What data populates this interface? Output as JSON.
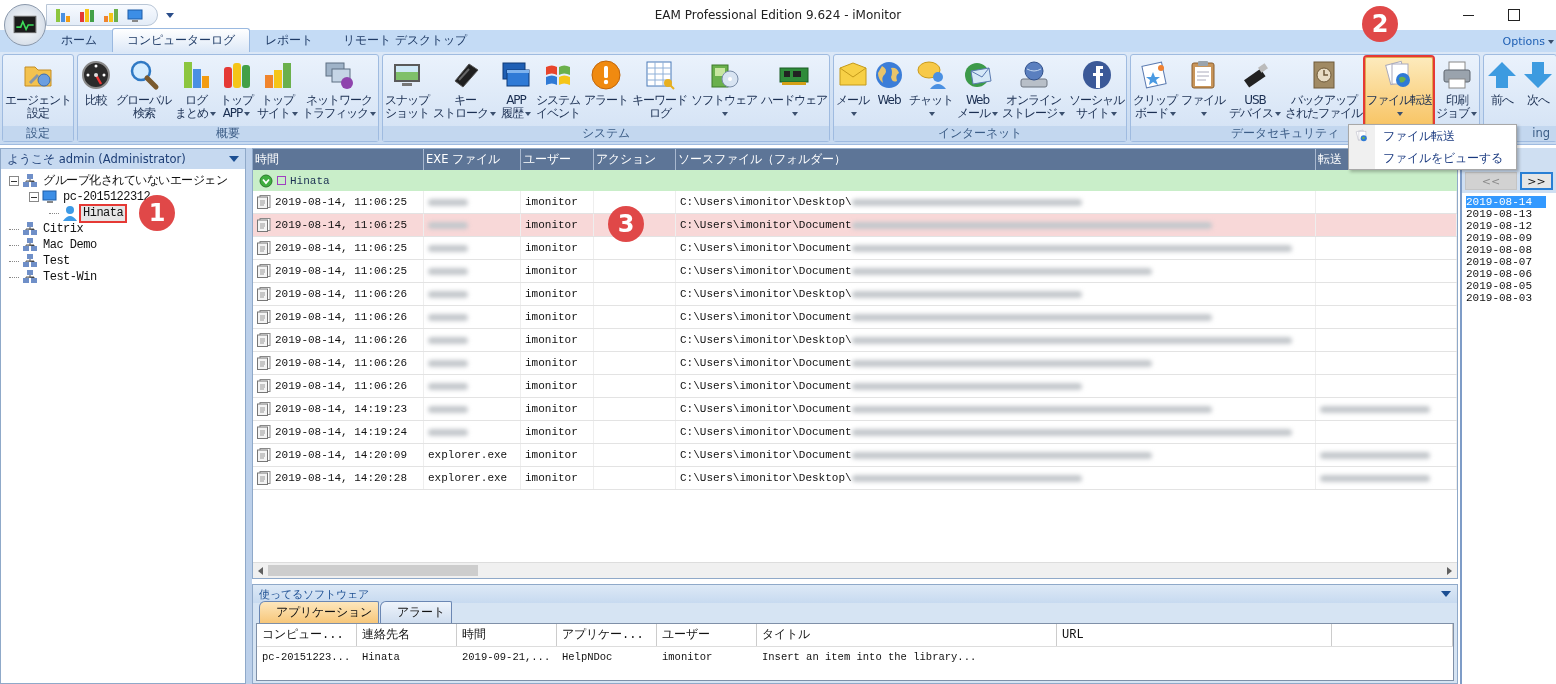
{
  "window": {
    "title": "EAM Professional Edition 9.624 - iMonitor"
  },
  "tabs": [
    {
      "label": "ホーム",
      "selected": false
    },
    {
      "label": "コンピューターログ",
      "selected": true
    },
    {
      "label": "レポート",
      "selected": false
    },
    {
      "label": "リモート デスクトップ",
      "selected": false
    }
  ],
  "options": {
    "label": "Options"
  },
  "ribbon": {
    "groups": [
      {
        "label": "設定",
        "buttons": [
          {
            "lines": [
              "エージェント",
              "設定"
            ],
            "dropdown": false,
            "open": false,
            "boxed": false
          }
        ]
      },
      {
        "label": "概要",
        "buttons": [
          {
            "lines": [
              "比較"
            ],
            "dropdown": false,
            "open": false,
            "boxed": false
          },
          {
            "lines": [
              "グローバル",
              "検索"
            ],
            "dropdown": false,
            "open": false,
            "boxed": false
          },
          {
            "lines": [
              "ログ",
              "まとめ"
            ],
            "dropdown": true,
            "open": false,
            "boxed": false
          },
          {
            "lines": [
              "トップ",
              "APP"
            ],
            "dropdown": true,
            "open": false,
            "boxed": false
          },
          {
            "lines": [
              "トップ",
              "サイト"
            ],
            "dropdown": true,
            "open": false,
            "boxed": false
          },
          {
            "lines": [
              "ネットワーク",
              "トラフィック"
            ],
            "dropdown": true,
            "open": false,
            "boxed": false
          }
        ]
      },
      {
        "label": "システム",
        "buttons": [
          {
            "lines": [
              "スナップ",
              "ショット"
            ],
            "dropdown": false,
            "open": false,
            "boxed": false
          },
          {
            "lines": [
              "キー",
              "ストローク"
            ],
            "dropdown": true,
            "open": false,
            "boxed": false
          },
          {
            "lines": [
              "APP",
              "履歴"
            ],
            "dropdown": true,
            "open": false,
            "boxed": false
          },
          {
            "lines": [
              "システム",
              "イベント"
            ],
            "dropdown": false,
            "open": false,
            "boxed": false
          },
          {
            "lines": [
              "アラート"
            ],
            "dropdown": false,
            "open": false,
            "boxed": false
          },
          {
            "lines": [
              "キーワード",
              "ログ"
            ],
            "dropdown": false,
            "open": false,
            "boxed": false
          },
          {
            "lines": [
              "ソフトウェア"
            ],
            "dropdown": true,
            "open": false,
            "boxed": false
          },
          {
            "lines": [
              "ハードウェア"
            ],
            "dropdown": true,
            "open": false,
            "boxed": false
          }
        ]
      },
      {
        "label": "インターネット",
        "buttons": [
          {
            "lines": [
              "メール"
            ],
            "dropdown": true,
            "open": false,
            "boxed": false
          },
          {
            "lines": [
              "Web"
            ],
            "dropdown": false,
            "open": false,
            "boxed": false
          },
          {
            "lines": [
              "チャット"
            ],
            "dropdown": true,
            "open": false,
            "boxed": false
          },
          {
            "lines": [
              "Web",
              "メール"
            ],
            "dropdown": true,
            "open": false,
            "boxed": false
          },
          {
            "lines": [
              "オンライン",
              "ストレージ"
            ],
            "dropdown": true,
            "open": false,
            "boxed": false
          },
          {
            "lines": [
              "ソーシャル",
              "サイト"
            ],
            "dropdown": true,
            "open": false,
            "boxed": false
          }
        ]
      },
      {
        "label": "データセキュリティ",
        "buttons": [
          {
            "lines": [
              "クリップ",
              "ボード"
            ],
            "dropdown": true,
            "open": false,
            "boxed": false
          },
          {
            "lines": [
              "ファイル"
            ],
            "dropdown": true,
            "open": false,
            "boxed": false
          },
          {
            "lines": [
              "USB",
              "デバイス"
            ],
            "dropdown": true,
            "open": false,
            "boxed": false
          },
          {
            "lines": [
              "バックアップ",
              "されたファイル"
            ],
            "dropdown": false,
            "open": false,
            "boxed": false
          },
          {
            "lines": [
              "ファイル転送"
            ],
            "dropdown": true,
            "open": true,
            "boxed": true
          },
          {
            "lines": [
              "印刷",
              "ジョブ"
            ],
            "dropdown": true,
            "open": false,
            "boxed": false
          }
        ]
      },
      {
        "label": "ing",
        "buttons": [
          {
            "lines": [
              "前へ"
            ],
            "dropdown": false,
            "open": false,
            "boxed": false
          },
          {
            "lines": [
              "次へ"
            ],
            "dropdown": false,
            "open": false,
            "boxed": false
          }
        ]
      }
    ]
  },
  "dropdown_menu": {
    "items": [
      "ファイル転送",
      "ファイルをビューする"
    ]
  },
  "sidebar": {
    "title": "ようこそ admin (Administrator)",
    "tree": [
      {
        "label": "グループ化されていないエージェン",
        "kind": "group",
        "expanded": true,
        "selected": false,
        "boxed": false,
        "children": [
          {
            "label": "pc-2015122312",
            "kind": "computer",
            "expanded": true,
            "selected": false,
            "boxed": false,
            "children": [
              {
                "label": "Hinata",
                "kind": "user",
                "selected": true,
                "boxed": true
              }
            ]
          }
        ]
      },
      {
        "label": "Citrix",
        "kind": "group",
        "selected": false,
        "boxed": false
      },
      {
        "label": "Mac Demo",
        "kind": "group",
        "selected": false,
        "boxed": false
      },
      {
        "label": "Test",
        "kind": "group",
        "selected": false,
        "boxed": false
      },
      {
        "label": "Test-Win",
        "kind": "group",
        "selected": false,
        "boxed": false
      }
    ]
  },
  "table": {
    "columns": [
      "時間",
      "EXE ファイル",
      "ユーザー",
      "アクション",
      "ソースファイル（フォルダー）",
      "転送"
    ],
    "group": {
      "label": "Hinata",
      "expanded": true
    },
    "rows": [
      {
        "time": "2019-08-14, 11:06:25",
        "user": "imonitor",
        "path": "C:\\Users\\imonitor\\Desktop\\",
        "selected": false,
        "transfer_blurred": false
      },
      {
        "time": "2019-08-14, 11:06:25",
        "user": "imonitor",
        "path": "C:\\Users\\imonitor\\Document",
        "selected": true,
        "transfer_blurred": false
      },
      {
        "time": "2019-08-14, 11:06:25",
        "user": "imonitor",
        "path": "C:\\Users\\imonitor\\Document",
        "selected": false,
        "transfer_blurred": false
      },
      {
        "time": "2019-08-14, 11:06:25",
        "user": "imonitor",
        "path": "C:\\Users\\imonitor\\Document",
        "selected": false,
        "transfer_blurred": false
      },
      {
        "time": "2019-08-14, 11:06:26",
        "user": "imonitor",
        "path": "C:\\Users\\imonitor\\Desktop\\",
        "selected": false,
        "transfer_blurred": false
      },
      {
        "time": "2019-08-14, 11:06:26",
        "user": "imonitor",
        "path": "C:\\Users\\imonitor\\Document",
        "selected": false,
        "transfer_blurred": false
      },
      {
        "time": "2019-08-14, 11:06:26",
        "user": "imonitor",
        "path": "C:\\Users\\imonitor\\Desktop\\",
        "selected": false,
        "transfer_blurred": false
      },
      {
        "time": "2019-08-14, 11:06:26",
        "user": "imonitor",
        "path": "C:\\Users\\imonitor\\Document",
        "selected": false,
        "transfer_blurred": false
      },
      {
        "time": "2019-08-14, 11:06:26",
        "user": "imonitor",
        "path": "C:\\Users\\imonitor\\Document",
        "selected": false,
        "transfer_blurred": false
      },
      {
        "time": "2019-08-14, 14:19:23",
        "user": "imonitor",
        "path": "C:\\Users\\imonitor\\Document",
        "selected": false,
        "transfer_blurred": true
      },
      {
        "time": "2019-08-14, 14:19:24",
        "user": "imonitor",
        "path": "C:\\Users\\imonitor\\Document",
        "selected": false,
        "transfer_blurred": false
      },
      {
        "time": "2019-08-14, 14:20:09",
        "exe": "explorer.exe",
        "user": "imonitor",
        "path": "C:\\Users\\imonitor\\Document",
        "selected": false,
        "transfer_blurred": true
      },
      {
        "time": "2019-08-14, 14:20:28",
        "exe": "explorer.exe",
        "user": "imonitor",
        "path": "C:\\Users\\imonitor\\Desktop\\",
        "selected": false,
        "transfer_blurred": true
      }
    ]
  },
  "bottom_panel": {
    "title": "使ってるソフトウェア",
    "tabs": [
      {
        "label": "アプリケーション",
        "selected": true
      },
      {
        "label": "アラート",
        "selected": false
      }
    ],
    "columns": [
      "コンピュー...",
      "連絡先名",
      "時間",
      "アプリケー...",
      "ユーザー",
      "タイトル",
      "URL"
    ],
    "rows": [
      {
        "cells": [
          "pc-20151223...",
          "Hinata",
          "2019-09-21,...",
          "HelpNDoc",
          "imonitor",
          "Insert an item into the library..."
        ]
      }
    ]
  },
  "date_panel": {
    "nav": [
      {
        "label": "<<",
        "disabled": true
      },
      {
        "label": ">>",
        "disabled": false
      }
    ],
    "dates": [
      {
        "label": "2019-08-14",
        "selected": true
      },
      {
        "label": "2019-08-13",
        "selected": false
      },
      {
        "label": "2019-08-12",
        "selected": false
      },
      {
        "label": "2019-08-09",
        "selected": false
      },
      {
        "label": "2019-08-08",
        "selected": false
      },
      {
        "label": "2019-08-07",
        "selected": false
      },
      {
        "label": "2019-08-06",
        "selected": false
      },
      {
        "label": "2019-08-05",
        "selected": false
      },
      {
        "label": "2019-08-03",
        "selected": false
      }
    ]
  },
  "annotations": [
    {
      "label": "1"
    },
    {
      "label": "2"
    },
    {
      "label": "3"
    }
  ]
}
